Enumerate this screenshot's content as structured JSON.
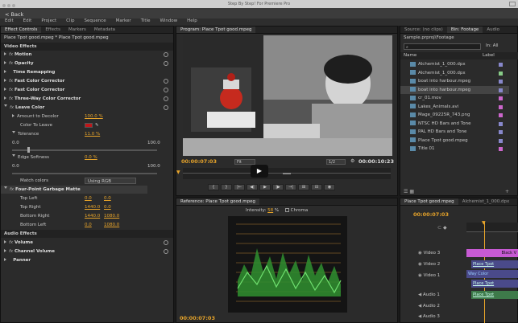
{
  "window": {
    "title": "Step By Step! For Premiere Pro",
    "back": "< Back"
  },
  "menu": [
    "Edit",
    "Edit",
    "Project",
    "Clip",
    "Sequence",
    "Marker",
    "Title",
    "Window",
    "Help"
  ],
  "effect_controls": {
    "tabs": [
      "Effect Controls",
      "Effects",
      "Markers",
      "Metadata"
    ],
    "clip": "Place Tpot good.mpeg * Place Tpot good.mpeg",
    "video_effects": "Video Effects",
    "effects": [
      {
        "name": "Motion",
        "fx": true
      },
      {
        "name": "Opacity",
        "fx": true
      },
      {
        "name": "Time Remapping",
        "fx": false
      },
      {
        "name": "Fast Color Corrector",
        "fx": true
      },
      {
        "name": "Fast Color Corrector",
        "fx": true
      },
      {
        "name": "Three-Way Color Corrector",
        "fx": true
      },
      {
        "name": "Leave Color",
        "fx": true
      }
    ],
    "amount_label": "Amount to Decolor",
    "amount_value": "100.0 %",
    "color_label": "Color To Leave",
    "tolerance_label": "Tolerance",
    "tolerance_value": "11.0 %",
    "scale_min": "0.0",
    "scale_max": "100.0",
    "edge_label": "Edge Softness",
    "edge_value": "0.0 %",
    "match_label": "Match colors",
    "match_value": "Using RGB",
    "garbage_label": "Four-Point Garbage Matte",
    "top_left": "Top Left",
    "top_left_x": "0.0",
    "top_left_y": "0.0",
    "top_right": "Top Right",
    "top_right_x": "1440.0",
    "top_right_y": "0.0",
    "bottom_right": "Bottom Right",
    "bottom_right_x": "1440.0",
    "bottom_right_y": "1080.0",
    "bottom_left": "Bottom Left",
    "bottom_left_x": "0.0",
    "bottom_left_y": "1080.0",
    "audio_effects": "Audio Effects",
    "audio": [
      {
        "name": "Volume"
      },
      {
        "name": "Channel Volume"
      },
      {
        "name": "Panner"
      }
    ],
    "accent": "#e7a42a"
  },
  "program": {
    "tab": "Program: Place Tpot good.mpeg",
    "timecode": "00:00:07:03",
    "fit": "Fit",
    "quality": "1/2",
    "duration": "00:00:10:23"
  },
  "project": {
    "tab_source": "Source: (no clips)",
    "tab_bin": "Bin: Footage",
    "tab_audio": "Audio",
    "path": "Sample.prproj\\Footage",
    "in_label": "In:",
    "in_value": "All",
    "col_name": "Name",
    "col_label": "Label",
    "files": [
      {
        "name": "Alchemist_1_000.dpx",
        "color": "#8888cc"
      },
      {
        "name": "Alchemist_1_000.dpx",
        "color": "#88cc88"
      },
      {
        "name": "boat into harbour.mpeg",
        "color": "#8888cc"
      },
      {
        "name": "boat into harbour.mpeg",
        "color": "#8888cc"
      },
      {
        "name": "cr_01.mov",
        "color": "#cc66cc"
      },
      {
        "name": "Lakes_Animals.avi",
        "color": "#cc66cc"
      },
      {
        "name": "Mage_09225R_743.png",
        "color": "#cc66cc"
      },
      {
        "name": "NTSC HD Bars and Tone",
        "color": "#8888cc"
      },
      {
        "name": "PAL HD Bars and Tone",
        "color": "#8888cc"
      },
      {
        "name": "Place Tpot good.mpeg",
        "color": "#8888cc"
      },
      {
        "name": "Title 01",
        "color": "#cc66cc"
      }
    ]
  },
  "reference": {
    "tab": "Reference: Place Tpot good.mpeg",
    "intensity_label": "Intensity:",
    "intensity_value": "58",
    "intensity_unit": "%",
    "chroma": "Chroma",
    "timecode": "00:00:07:03"
  },
  "timeline": {
    "tab1": "Place Tpot good.mpeg",
    "tab2": "Alchemist_1_000.dpx",
    "tab3": "bo",
    "timecode": "00:00:07:03",
    "tracks": [
      {
        "name": "Video 3"
      },
      {
        "name": "Video 2"
      },
      {
        "name": "Video 1"
      },
      {
        "name": "Audio 1"
      },
      {
        "name": "Audio 2"
      },
      {
        "name": "Audio 3"
      }
    ],
    "clip_v3": "Black V",
    "clip_v2": "Place Tpot good.mpeg",
    "clip_v1": "Way Color Corrector:Outp",
    "clip_v1b": "Place Tpot good.mpeg",
    "clip_a1": "Place Tpot good.mpeg"
  }
}
